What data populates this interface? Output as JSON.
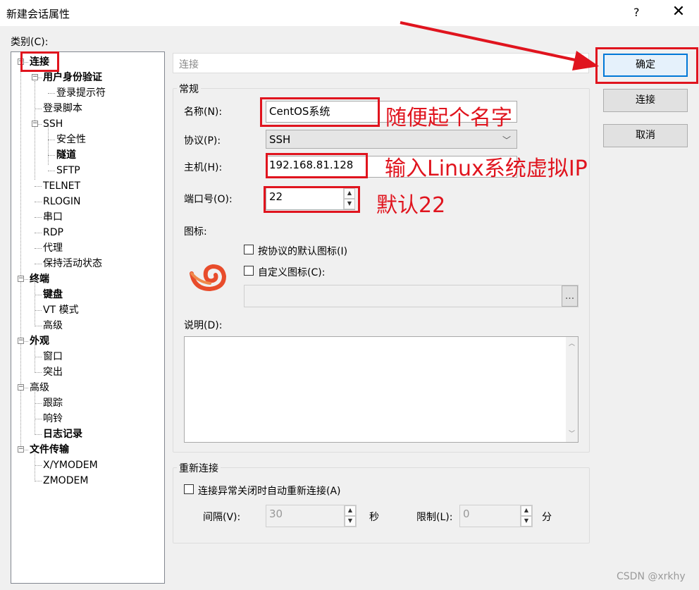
{
  "window": {
    "title": "新建会话属性",
    "help_label": "?",
    "close_label": "✕"
  },
  "category_label": "类别(C):",
  "tree": [
    {
      "label": "连接",
      "bold": true
    },
    {
      "label": "用户身份验证",
      "bold": true
    },
    {
      "label": "登录提示符",
      "bold": false
    },
    {
      "label": "登录脚本",
      "bold": false
    },
    {
      "label": "SSH",
      "bold": false
    },
    {
      "label": "安全性",
      "bold": false
    },
    {
      "label": "隧道",
      "bold": true
    },
    {
      "label": "SFTP",
      "bold": false
    },
    {
      "label": "TELNET",
      "bold": false
    },
    {
      "label": "RLOGIN",
      "bold": false
    },
    {
      "label": "串口",
      "bold": false
    },
    {
      "label": "RDP",
      "bold": false
    },
    {
      "label": "代理",
      "bold": false
    },
    {
      "label": "保持活动状态",
      "bold": false
    },
    {
      "label": "终端",
      "bold": true
    },
    {
      "label": "键盘",
      "bold": true
    },
    {
      "label": "VT 模式",
      "bold": false
    },
    {
      "label": "高级",
      "bold": false
    },
    {
      "label": "外观",
      "bold": true
    },
    {
      "label": "窗口",
      "bold": false
    },
    {
      "label": "突出",
      "bold": false
    },
    {
      "label": "高级",
      "bold": false
    },
    {
      "label": "跟踪",
      "bold": false
    },
    {
      "label": "响铃",
      "bold": false
    },
    {
      "label": "日志记录",
      "bold": true
    },
    {
      "label": "文件传输",
      "bold": true
    },
    {
      "label": "X/YMODEM",
      "bold": false
    },
    {
      "label": "ZMODEM",
      "bold": false
    }
  ],
  "header": {
    "title": "连接"
  },
  "general": {
    "title": "常规",
    "name_label": "名称(N):",
    "name_value": "CentOS系统",
    "protocol_label": "协议(P):",
    "protocol_value": "SSH",
    "host_label": "主机(H):",
    "host_value": "192.168.81.128",
    "port_label": "端口号(O):",
    "port_value": "22",
    "icon_label": "图标:",
    "icon_name": "xshell-swirl-icon",
    "default_icon_label": "按协议的默认图标(I)",
    "custom_icon_label": "自定义图标(C):",
    "browse_label": "...",
    "desc_label": "说明(D):"
  },
  "reconnect": {
    "title": "重新连接",
    "auto_label": "连接异常关闭时自动重新连接(A)",
    "interval_label": "间隔(V):",
    "interval_value": "30",
    "interval_unit": "秒",
    "limit_label": "限制(L):",
    "limit_value": "0",
    "limit_unit": "分"
  },
  "buttons": {
    "ok": "确定",
    "connect": "连接",
    "cancel": "取消"
  },
  "annotations": {
    "name_note": "随便起个名字",
    "host_note": "输入Linux系统虚拟IP",
    "port_note": "默认22"
  },
  "watermark": "CSDN @xrkhy",
  "colors": {
    "annotation_red": "#e0141e",
    "focus_blue": "#0078d7"
  }
}
